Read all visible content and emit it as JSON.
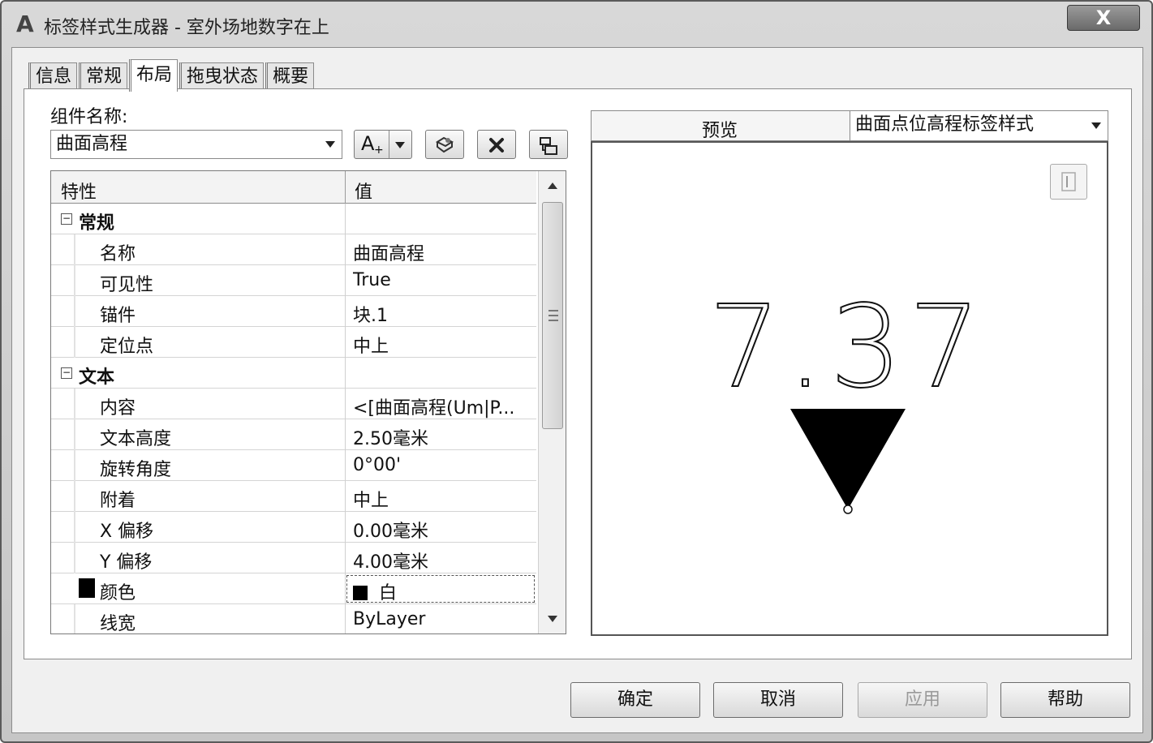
{
  "window": {
    "title": "标签样式生成器 - 室外场地数字在上",
    "close_label": "X",
    "app_icon_letter": "A"
  },
  "tabs": [
    {
      "label": "信息",
      "active": false
    },
    {
      "label": "常规",
      "active": false
    },
    {
      "label": "布局",
      "active": true
    },
    {
      "label": "拖曳状态",
      "active": false
    },
    {
      "label": "概要",
      "active": false
    }
  ],
  "component": {
    "label": "组件名称:",
    "selected": "曲面高程"
  },
  "toolbar": {
    "add_icon": "add-text-component-icon",
    "pick_icon": "copy-component-icon",
    "delete_icon": "delete-component-icon",
    "order_icon": "component-order-icon",
    "add_label": "A"
  },
  "grid": {
    "header_property": "特性",
    "header_value": "值",
    "rows": [
      {
        "type": "category",
        "label": "常规",
        "value": "",
        "toggle": "⊟"
      },
      {
        "type": "prop",
        "label": "名称",
        "value": "曲面高程"
      },
      {
        "type": "prop",
        "label": "可见性",
        "value": "True"
      },
      {
        "type": "prop",
        "label": "锚件",
        "value": "块.1"
      },
      {
        "type": "prop",
        "label": "定位点",
        "value": "中上"
      },
      {
        "type": "category",
        "label": "文本",
        "value": "",
        "toggle": "⊟"
      },
      {
        "type": "prop",
        "label": "内容",
        "value": "<[曲面高程(Um|P..."
      },
      {
        "type": "prop",
        "label": "文本高度",
        "value": "2.50毫米"
      },
      {
        "type": "prop",
        "label": "旋转角度",
        "value": "0°00'"
      },
      {
        "type": "prop",
        "label": "附着",
        "value": "中上"
      },
      {
        "type": "prop",
        "label": "X 偏移",
        "value": "0.00毫米"
      },
      {
        "type": "prop",
        "label": "Y 偏移",
        "value": "4.00毫米"
      },
      {
        "type": "color",
        "label": "颜色",
        "value": "白"
      },
      {
        "type": "prop",
        "label": "线宽",
        "value": "ByLayer"
      }
    ]
  },
  "preview": {
    "label": "预览",
    "style_selected": "曲面点位高程标签样式",
    "sample_text": "7.37",
    "marker_color": "#000000"
  },
  "buttons": {
    "ok": "确定",
    "cancel": "取消",
    "apply": "应用",
    "help": "帮助"
  }
}
